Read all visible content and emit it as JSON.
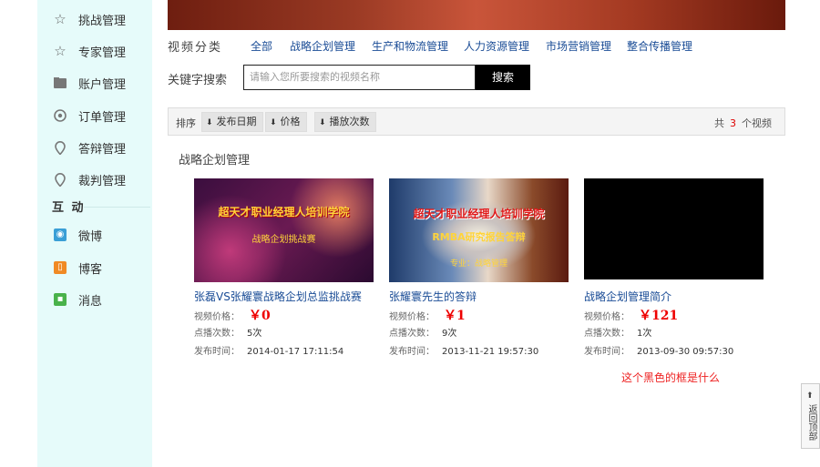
{
  "sidebar": {
    "items": [
      {
        "label": "挑战管理",
        "icon": "star-outline-icon"
      },
      {
        "label": "专家管理",
        "icon": "star-outline-icon"
      },
      {
        "label": "账户管理",
        "icon": "folder-icon"
      },
      {
        "label": "订单管理",
        "icon": "target-icon"
      },
      {
        "label": "答辩管理",
        "icon": "location-pin-icon"
      },
      {
        "label": "裁判管理",
        "icon": "location-pin-icon"
      }
    ],
    "section_title": "互 动",
    "interact_items": [
      {
        "label": "微博",
        "icon": "weibo-icon",
        "color": "#3a9fd6"
      },
      {
        "label": "博客",
        "icon": "book-icon",
        "color": "#f08a24"
      },
      {
        "label": "消息",
        "icon": "message-icon",
        "color": "#49b24b"
      }
    ]
  },
  "categories": {
    "title": "视频分类",
    "links": [
      "全部",
      "战略企划管理",
      "生产和物流管理",
      "人力资源管理",
      "市场营销管理",
      "整合传播管理"
    ]
  },
  "search": {
    "label": "关键字搜索",
    "placeholder": "请输入您所要搜索的视频名称",
    "button": "搜索"
  },
  "sortbar": {
    "label": "排序",
    "options": [
      "发布日期",
      "价格",
      "播放次数"
    ],
    "total_prefix": "共",
    "total_count": "3",
    "total_suffix": "个视频"
  },
  "section_title": "战略企划管理",
  "videos": [
    {
      "thumb_line1": "超天才职业经理人培训学院",
      "thumb_line2": "战略企划挑战赛",
      "title": "张磊VS张耀寰战略企划总监挑战赛",
      "price_label": "视频价格：",
      "price": "￥0",
      "plays_label": "点播次数：",
      "plays": "5次",
      "date_label": "发布时间：",
      "date": "2014-01-17 17:11:54"
    },
    {
      "thumb_line1": "超天才职业经理人培训学院",
      "thumb_line2": "RMBA研究报告答辩",
      "thumb_line3": "专业：战略管理",
      "title": "张耀寰先生的答辩",
      "price_label": "视频价格：",
      "price": "￥1",
      "plays_label": "点播次数：",
      "plays": "9次",
      "date_label": "发布时间：",
      "date": "2013-11-21 19:57:30"
    },
    {
      "title": "战略企划管理简介",
      "price_label": "视频价格：",
      "price": "￥121",
      "plays_label": "点播次数：",
      "plays": "1次",
      "date_label": "发布时间：",
      "date": "2013-09-30 09:57:30"
    }
  ],
  "annotation": "这个黑色的框是什么",
  "back_to_top": "返回顶部",
  "colors": {
    "accent_red": "#e00000",
    "link_blue": "#1a4c96",
    "sidebar_bg": "#e6fbfa"
  }
}
